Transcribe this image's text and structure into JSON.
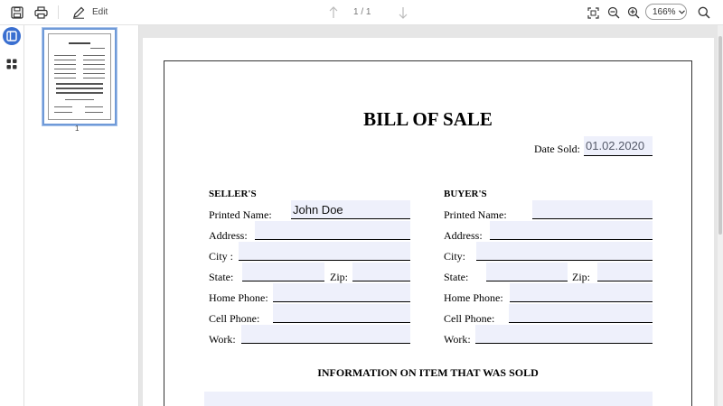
{
  "toolbar": {
    "edit_label": "Edit",
    "page_indicator": "1 / 1",
    "zoom_value": "166%"
  },
  "thumbnail": {
    "page_number": "1"
  },
  "document": {
    "title": "BILL OF SALE",
    "date_label": "Date Sold:",
    "date_value": "01.02.2020",
    "seller": {
      "heading": "SELLER'S",
      "printed_name_label": "Printed Name:",
      "printed_name_value": "John Doe",
      "address_label": "Address:",
      "city_label": "City :",
      "state_label": "State:",
      "zip_label": "Zip:",
      "home_phone_label": "Home Phone:",
      "cell_phone_label": "Cell Phone:",
      "work_label": "Work:"
    },
    "buyer": {
      "heading": "BUYER'S",
      "printed_name_label": "Printed Name:",
      "address_label": "Address:",
      "city_label": "City:",
      "state_label": "State:",
      "zip_label": "Zip:",
      "home_phone_label": "Home Phone:",
      "cell_phone_label": "Cell Phone:",
      "work_label": "Work:"
    },
    "section_heading": "INFORMATION ON ITEM THAT WAS SOLD"
  },
  "colors": {
    "field_fill": "#eef0fb",
    "thumb_border": "#6f9ad8",
    "viewer_bg": "#e6e6e6"
  }
}
